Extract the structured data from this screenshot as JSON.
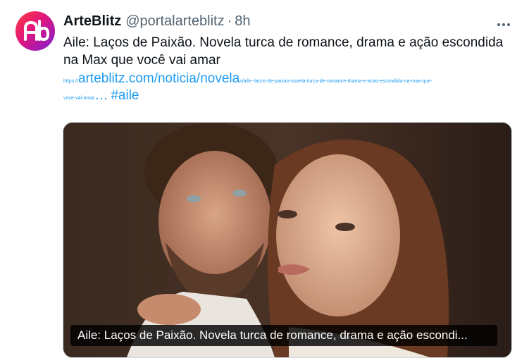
{
  "tweet": {
    "author_name": "ArteBlitz",
    "handle": "@portalarteblitz",
    "separator": "·",
    "time": "8h",
    "more_icon": "more-horizontal-icon",
    "text": "Aile: Laços de Paixão. Novela turca de romance, drama e ação escondida na Max que você vai amar",
    "link_prefix": "https://",
    "link_domain": "arteblitz.com/noticia/novela",
    "link_tail": "s/aile--lacos-de-paixao-novela-turca-de-romance-drama-e-acao-escondida-na-max-que-",
    "link_tail2": "voce-vai-amar",
    "link_ellipsis": "…",
    "hashtag": "#aile",
    "media_caption": "Aile: Laços de Paixão. Novela turca de romance, drama e ação escondi...",
    "avatar_letters": "Ab"
  },
  "colors": {
    "link": "#1d9bf0",
    "secondary_text": "#536471",
    "primary_text": "#0f1419",
    "avatar_gradient": [
      "#ff3b3b",
      "#e0167d",
      "#7a1fd6"
    ]
  }
}
